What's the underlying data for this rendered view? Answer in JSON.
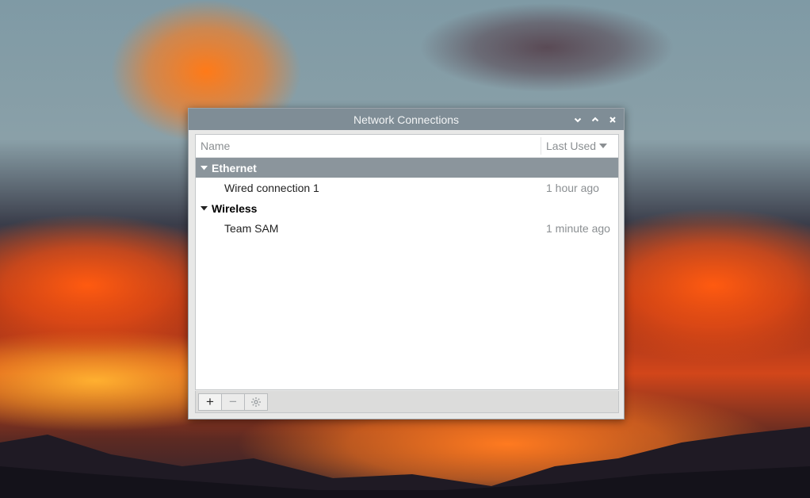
{
  "window": {
    "title": "Network Connections",
    "controls": [
      "minimize-icon",
      "maximize-icon",
      "close-icon"
    ]
  },
  "columns": {
    "name": "Name",
    "last_used": "Last Used"
  },
  "groups": [
    {
      "label": "Ethernet",
      "selected": true,
      "items": [
        {
          "name": "Wired connection 1",
          "last_used": "1 hour ago"
        }
      ]
    },
    {
      "label": "Wireless",
      "selected": false,
      "items": [
        {
          "name": "Team SAM",
          "last_used": "1 minute ago"
        }
      ]
    }
  ],
  "toolbar": {
    "add_label": "+",
    "remove_label": "−",
    "settings_icon": "gear-icon"
  },
  "colors": {
    "titlebar": "#7f8d96",
    "selection": "#8b959c"
  }
}
